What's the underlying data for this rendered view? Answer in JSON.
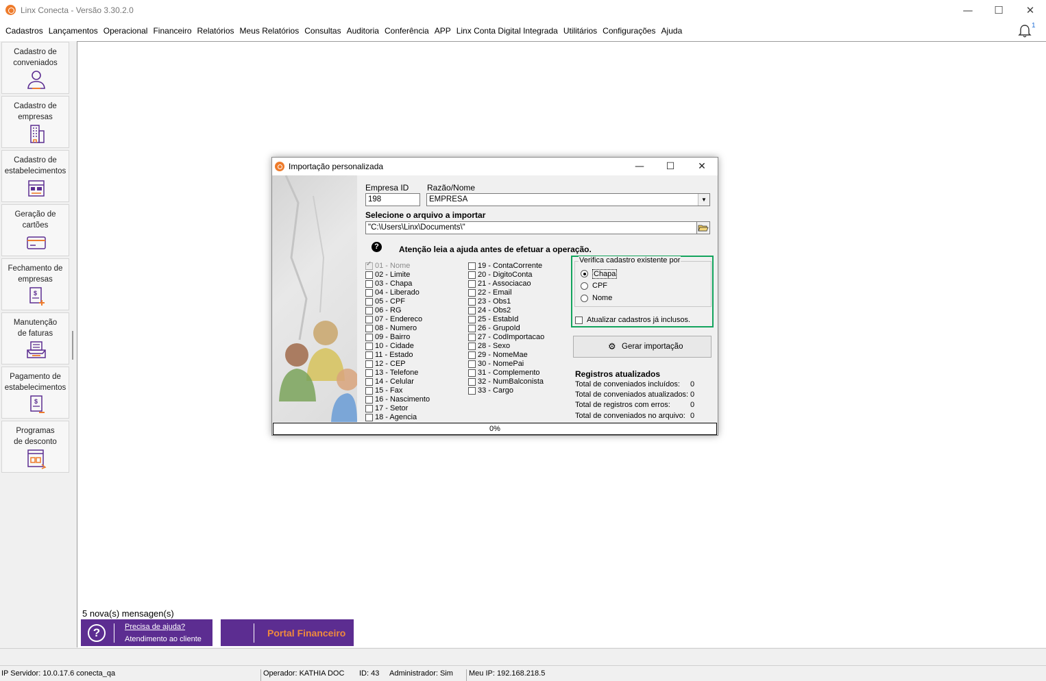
{
  "window": {
    "title": "Linx Conecta - Versão 3.30.2.0",
    "minimize": "—",
    "maximize": "☐",
    "close": "✕"
  },
  "menu": [
    "Cadastros",
    "Lançamentos",
    "Operacional",
    "Financeiro",
    "Relatórios",
    "Meus Relatórios",
    "Consultas",
    "Auditoria",
    "Conferência",
    "APP",
    "Linx Conta Digital Integrada",
    "Utilitários",
    "Configurações",
    "Ajuda"
  ],
  "notifications": {
    "count": "1",
    "icon": "bell-icon"
  },
  "sidebar": {
    "items": [
      {
        "label": "Cadastro de\nconveniados",
        "icon": "person-icon"
      },
      {
        "label": "Cadastro de\nempresas",
        "icon": "building-icon"
      },
      {
        "label": "Cadastro de\nestabelecimentos",
        "icon": "store-icon"
      },
      {
        "label": "Geração de\ncartões",
        "icon": "card-icon"
      },
      {
        "label": "Fechamento de\nempresas",
        "icon": "invoice-close-icon"
      },
      {
        "label": "Manutenção\nde faturas",
        "icon": "tray-icon"
      },
      {
        "label": "Pagamento de\nestabelecimentos",
        "icon": "payment-icon"
      },
      {
        "label": "Programas\nde desconto",
        "icon": "discount-icon"
      }
    ]
  },
  "footer": {
    "messages": "5 nova(s) mensagen(s)",
    "help_line1": "Precisa de ajuda?",
    "help_line2": "Atendimento ao cliente",
    "help_icon": "?",
    "portal": "Portal Financeiro"
  },
  "status": {
    "server": "IP Servidor: 10.0.17.6 conecta_qa",
    "operator": "Operador: KATHIA DOC",
    "id": "ID: 43",
    "admin": "Administrador: Sim",
    "myip": "Meu IP: 192.168.218.5"
  },
  "dialog": {
    "title": "Importação personalizada",
    "empresa_id_label": "Empresa ID",
    "empresa_id_value": "198",
    "razao_label": "Razão/Nome",
    "razao_value": "EMPRESA",
    "arquivo_label": "Selecione o arquivo a importar",
    "arquivo_value": "\"C:\\Users\\Linx\\Documents\\\"",
    "help_icon": "?",
    "attention": "Atenção leia a ajuda antes de efetuar a operação.",
    "fields_col1": [
      "01 - Nome",
      "02 - Limite",
      "03 - Chapa",
      "04 - Liberado",
      "05 - CPF",
      "06 - RG",
      "07 - Endereco",
      "08 - Numero",
      "09 - Bairro",
      "10 - Cidade",
      "11 - Estado",
      "12 - CEP",
      "13 - Telefone",
      "14 - Celular",
      "15 - Fax",
      "16 - Nascimento",
      "17 - Setor",
      "18 - Agencia"
    ],
    "fields_col2": [
      "19 - ContaCorrente",
      "20 - DigitoConta",
      "21 - Associacao",
      "22 - Email",
      "23 - Obs1",
      "24 - Obs2",
      "25 - EstabId",
      "26 - GrupoId",
      "27 - CodImportacao",
      "28 - Sexo",
      "29 - NomeMae",
      "30 - NomePai",
      "31 - Complemento",
      "32 - NumBalconista",
      "33 - Cargo"
    ],
    "verifica_legend": "Verifica cadastro existente por",
    "radios": [
      "Chapa",
      "CPF",
      "Nome"
    ],
    "selected_radio": "Chapa",
    "atualizar_label": "Atualizar cadastros já inclusos.",
    "gerar_button": "Gerar importação",
    "registros_title": "Registros atualizados",
    "stats": [
      {
        "label": "Total de conveniados incluídos:",
        "value": "0"
      },
      {
        "label": "Total de conveniados atualizados:",
        "value": "0"
      },
      {
        "label": "Total de registros com erros:",
        "value": "0"
      },
      {
        "label": "Total de conveniados no arquivo:",
        "value": "0"
      }
    ],
    "progress": "0%"
  }
}
